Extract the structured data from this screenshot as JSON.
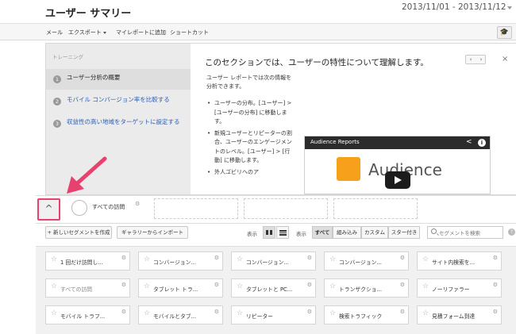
{
  "header": {
    "title": "ユーザー サマリー",
    "date_range": "2013/11/01 - 2013/11/12"
  },
  "toolbar": {
    "items": [
      "メール",
      "エクスポート",
      "マイレポートに追加",
      "ショートカット"
    ]
  },
  "training": {
    "label": "トレーニング",
    "steps": [
      {
        "num": "1",
        "label": "ユーザー分析の概要"
      },
      {
        "num": "2",
        "label": "モバイル コンバージョン率を比較する"
      },
      {
        "num": "3",
        "label": "収益性の高い地域をターゲットに設定する"
      }
    ],
    "title": "このセクションでは、ユーザーの特性について理解します。",
    "intro": "ユーザー レポートでは次の情報を分析できます。",
    "bullets": [
      "ユーザーの分布。[ユーザー] > [ユーザーの分布] に移動します。",
      "新規ユーザーとリピーターの割合、ユーザーのエンゲージメントのレベル。[ユーザー] > [行動] に移動します。",
      "外人ユ゙ビリへのア"
    ],
    "video": {
      "title": "Audience Reports",
      "word": "Audience"
    }
  },
  "segments": {
    "active_label": "すべての訪問",
    "new_button": "+ 新しいセグメントを作成",
    "import_button": "ギャラリーからインポート",
    "view_label_1": "表示",
    "view_label_2": "表示",
    "filters": [
      "すべて",
      "組み込み",
      "カスタム",
      "スター付き"
    ],
    "search_placeholder": "セグメントを検索",
    "tiles": [
      [
        "1 回だけ訪問し...",
        "コンバージョン...",
        "コンバージョン...",
        "コンバージョン...",
        "サイト内検索を..."
      ],
      [
        "すべての訪問",
        "タブレット トラ...",
        "タブレットと PC...",
        "トランザクショ...",
        "ノーリファラー"
      ],
      [
        "モバイル トラフ...",
        "モバイルとタブ...",
        "リピーター",
        "検索トラフィック",
        "見積フォーム到達"
      ]
    ]
  },
  "colors": {
    "annotation": "#e8416f",
    "link": "#2a5db0"
  }
}
